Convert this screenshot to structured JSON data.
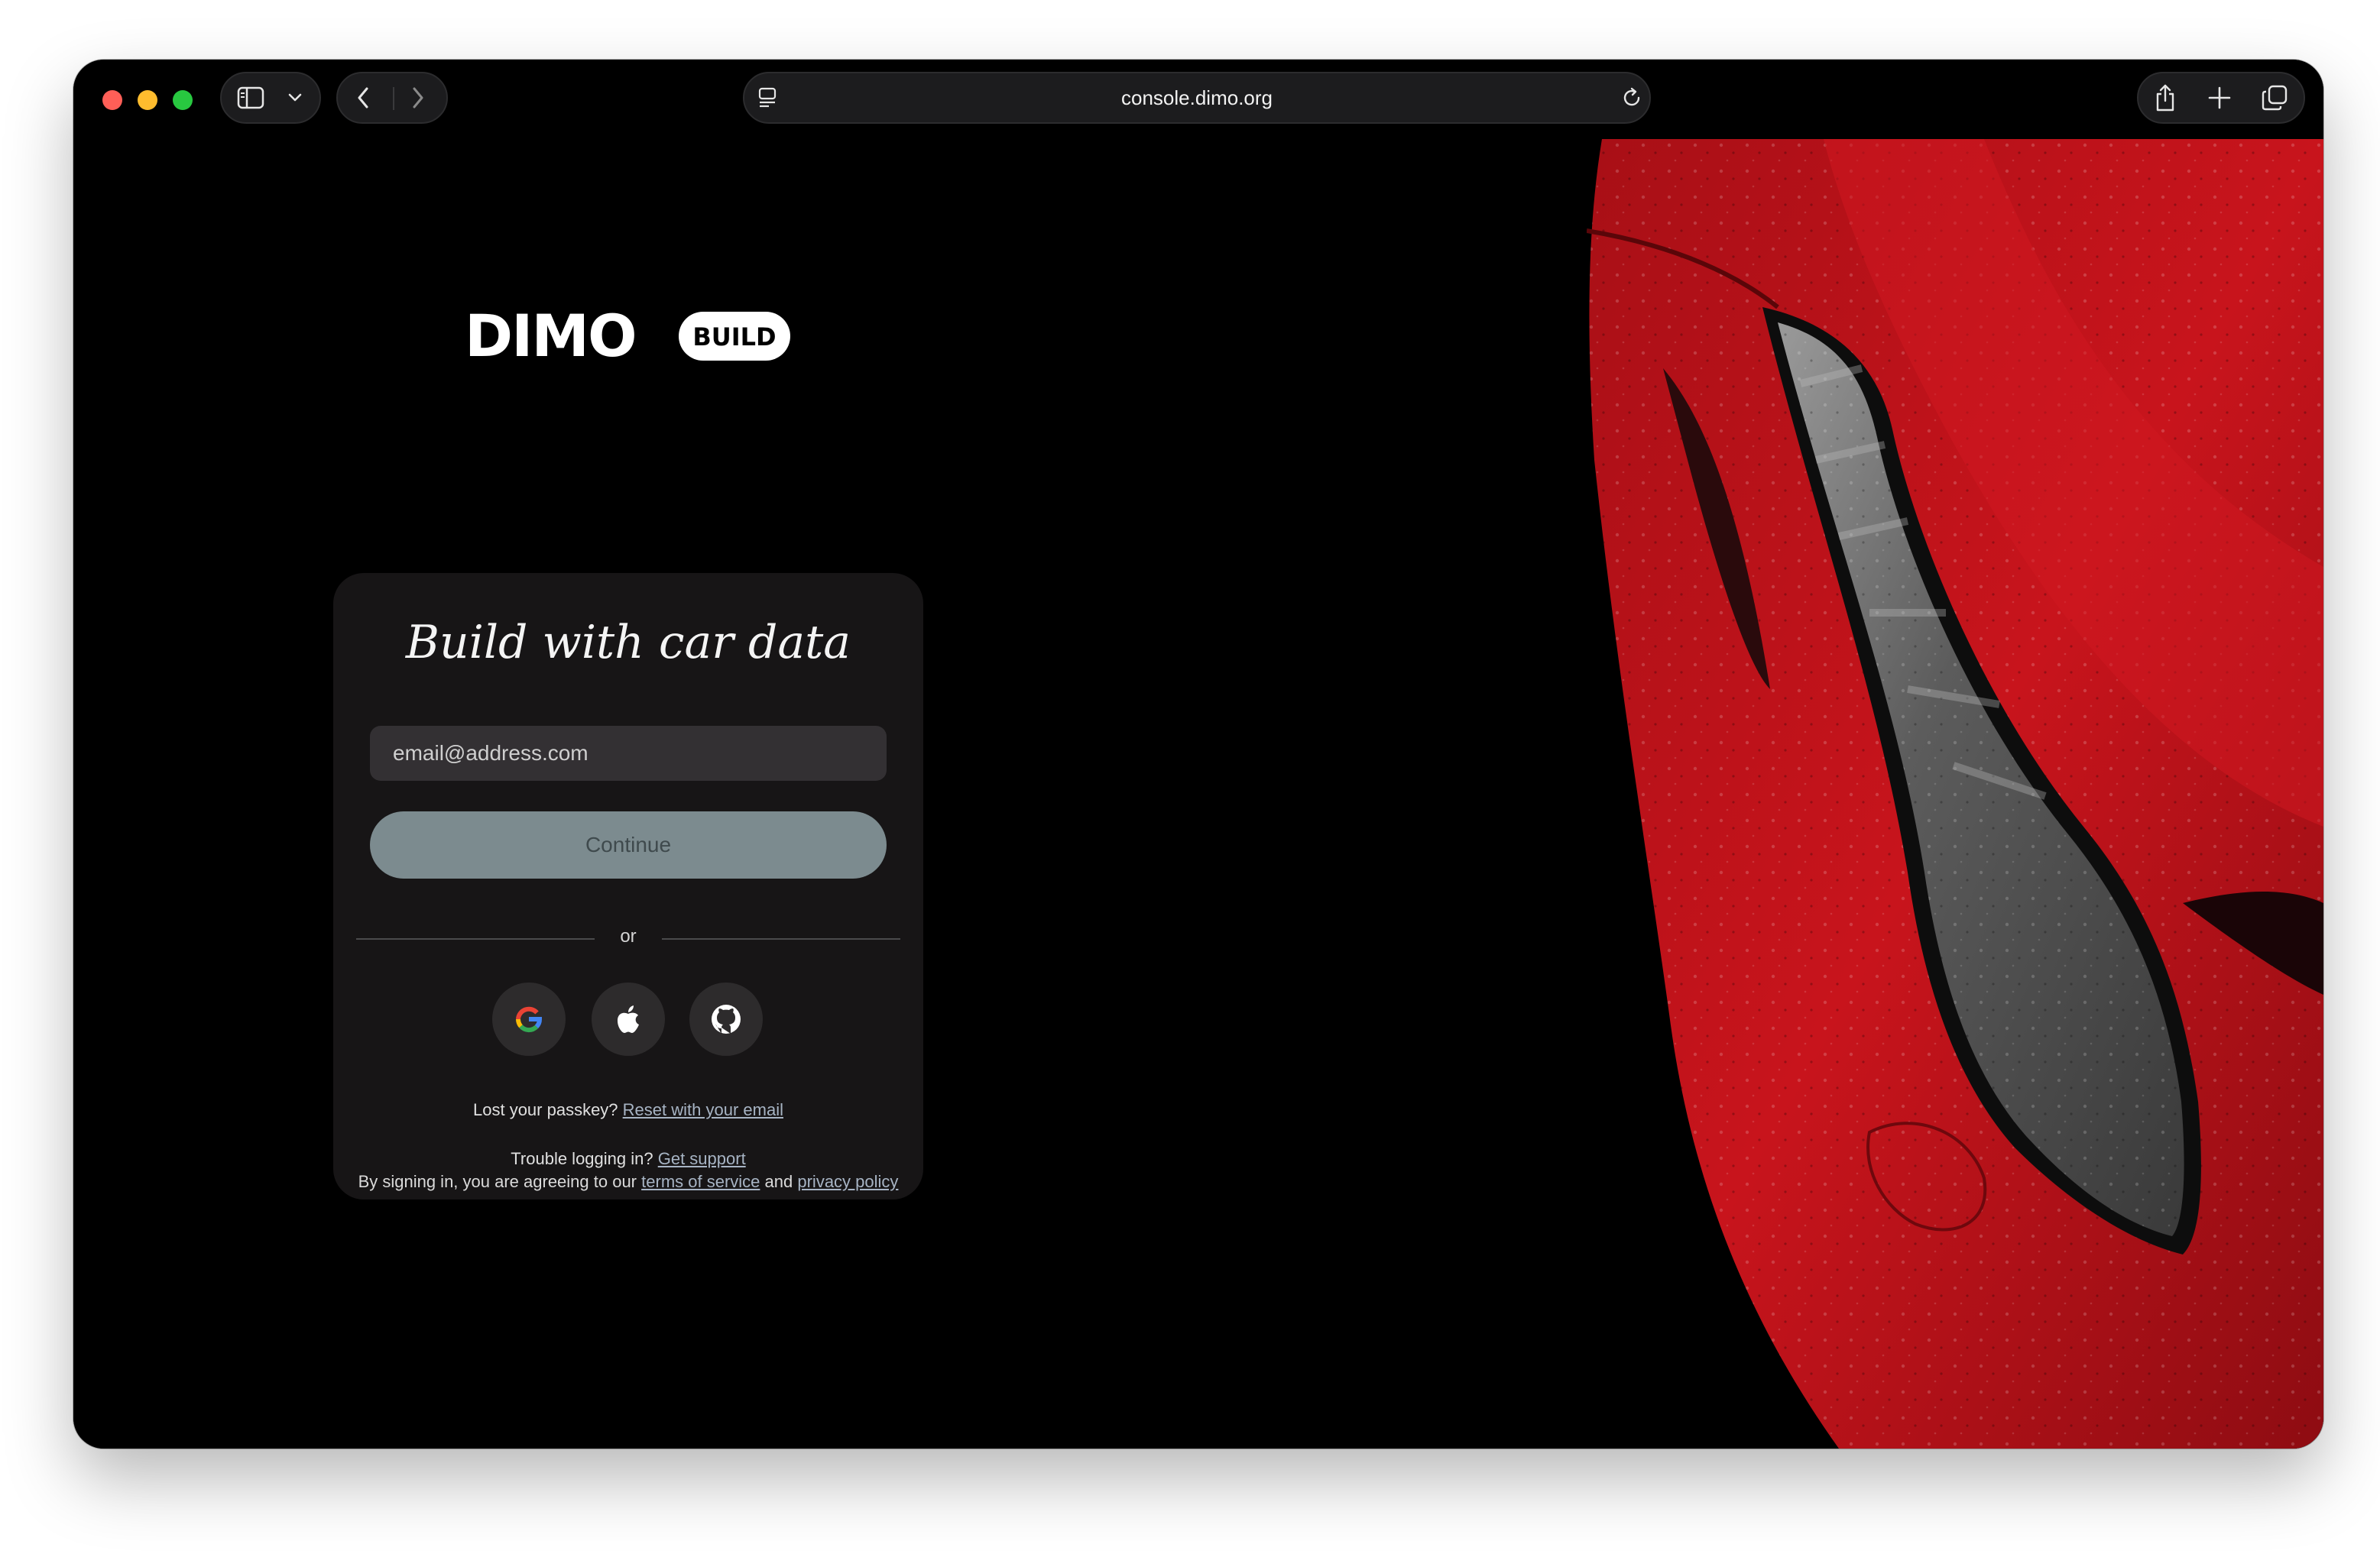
{
  "browser": {
    "url": "console.dimo.org",
    "icons": {
      "sidebar": "sidebar-icon",
      "chevron": "chevron-down-icon",
      "back": "chevron-left-icon",
      "forward": "chevron-right-icon",
      "site_settings": "page-settings-icon",
      "reload": "reload-icon",
      "share": "share-icon",
      "new_tab": "plus-icon",
      "tabs": "tab-overview-icon"
    }
  },
  "brand": {
    "logo_text": "DIMO",
    "badge": "BUILD"
  },
  "login": {
    "title": "Build with car data",
    "email_placeholder": "email@address.com",
    "continue_label": "Continue",
    "divider": "or",
    "social_providers": [
      "google-icon",
      "apple-icon",
      "github-icon"
    ],
    "passkey_prompt": "Lost your passkey?",
    "passkey_link": "Reset with your email",
    "trouble_prompt": "Trouble logging in?",
    "support_link": "Get support"
  },
  "footer": {
    "prefix": "By signing in, you are agreeing to our",
    "terms_link": "terms of service",
    "and_text": "and",
    "privacy_link": "privacy policy"
  },
  "colors": {
    "background": "#000000",
    "card": "#171516",
    "continue_button": "#7c8b8f",
    "link": "#a7b4c4",
    "car_red": "#c8141c"
  }
}
